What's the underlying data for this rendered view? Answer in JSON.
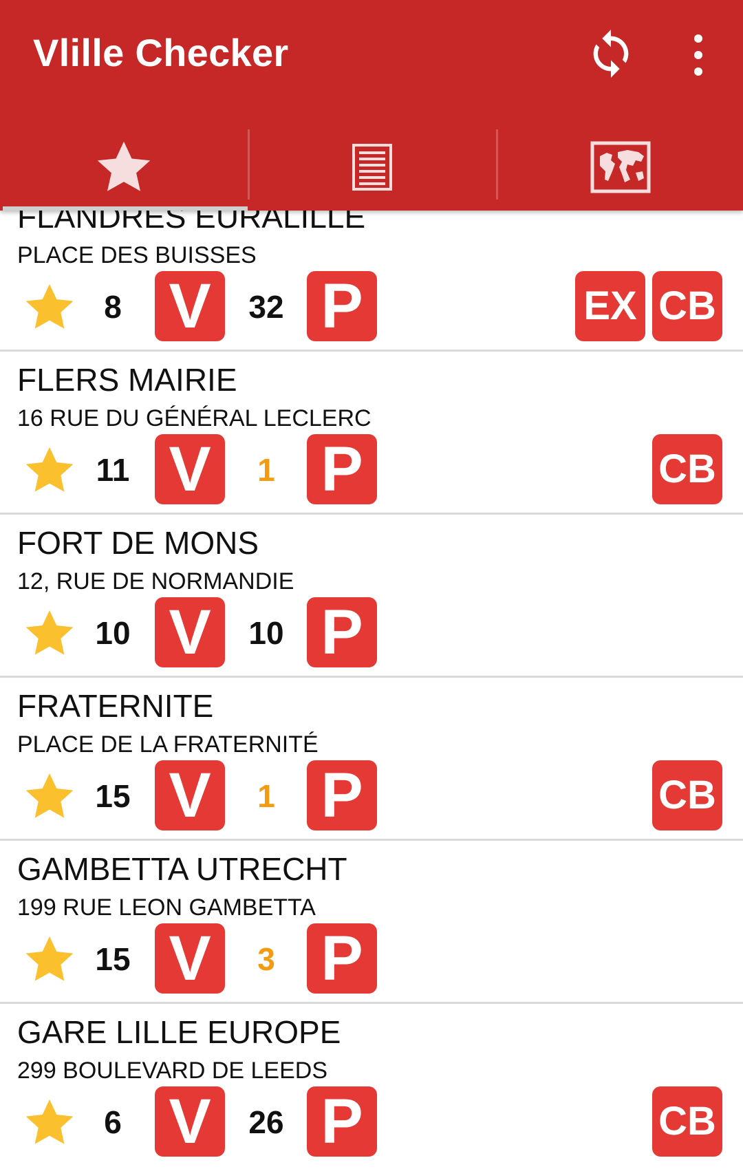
{
  "app": {
    "title": "Vlille Checker"
  },
  "toolbar": {
    "refresh_icon": "refresh-icon",
    "menu_icon": "more-vert-icon"
  },
  "tabs": [
    {
      "id": "favorites",
      "icon": "star-icon",
      "selected": true
    },
    {
      "id": "list",
      "icon": "list-icon",
      "selected": false
    },
    {
      "id": "map",
      "icon": "map-icon",
      "selected": false
    }
  ],
  "colors": {
    "appbar": "#c62828",
    "tile": "#e53935",
    "star": "#fbc02d",
    "low_count": "#f39c12"
  },
  "stations": [
    {
      "name": "FLANDRES EURALILLE",
      "address": "PLACE DES BUISSES",
      "bikes": "8",
      "stands": "32",
      "v_label": "V",
      "p_label": "P",
      "ex_label": "EX",
      "cb_label": "CB"
    },
    {
      "name": "FLERS MAIRIE",
      "address": "16 RUE DU GÉNÉRAL LECLERC",
      "bikes": "11",
      "stands": "1",
      "v_label": "V",
      "p_label": "P",
      "cb_label": "CB"
    },
    {
      "name": "FORT DE MONS",
      "address": "12, RUE DE NORMANDIE",
      "bikes": "10",
      "stands": "10",
      "v_label": "V",
      "p_label": "P"
    },
    {
      "name": "FRATERNITE",
      "address": "PLACE DE LA FRATERNITÉ",
      "bikes": "15",
      "stands": "1",
      "v_label": "V",
      "p_label": "P",
      "cb_label": "CB"
    },
    {
      "name": "GAMBETTA UTRECHT",
      "address": "199 RUE LEON GAMBETTA",
      "bikes": "15",
      "stands": "3",
      "v_label": "V",
      "p_label": "P"
    },
    {
      "name": "GARE LILLE EUROPE",
      "address": "299 BOULEVARD DE LEEDS",
      "bikes": "6",
      "stands": "26",
      "v_label": "V",
      "p_label": "P",
      "cb_label": "CB"
    }
  ]
}
